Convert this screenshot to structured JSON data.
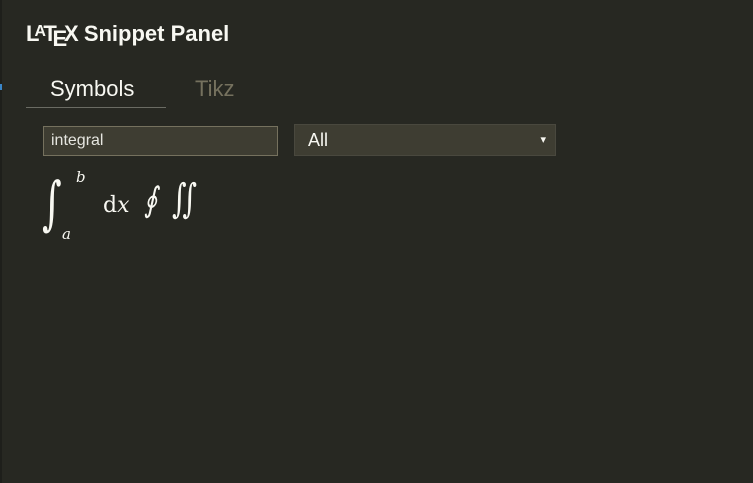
{
  "panel": {
    "title_logo": "LaTeX",
    "title_rest": " Snippet Panel"
  },
  "tabs": [
    {
      "label": "Symbols",
      "active": true
    },
    {
      "label": "Tikz",
      "active": false
    }
  ],
  "search": {
    "value": "integral",
    "placeholder": ""
  },
  "filter": {
    "selected": "All",
    "arrow": "▾"
  },
  "symbols": [
    {
      "name": "int-a-b",
      "glyph": "∫",
      "upper": "b",
      "lower": "a"
    },
    {
      "name": "dx",
      "prefix": "d",
      "var": "x"
    },
    {
      "name": "oint",
      "glyph": "∮"
    },
    {
      "name": "iint",
      "glyph": "∫∫"
    }
  ],
  "colors": {
    "background": "#272822",
    "text": "#f8f8f2",
    "muted": "#75715e",
    "field": "#3e3d32"
  }
}
